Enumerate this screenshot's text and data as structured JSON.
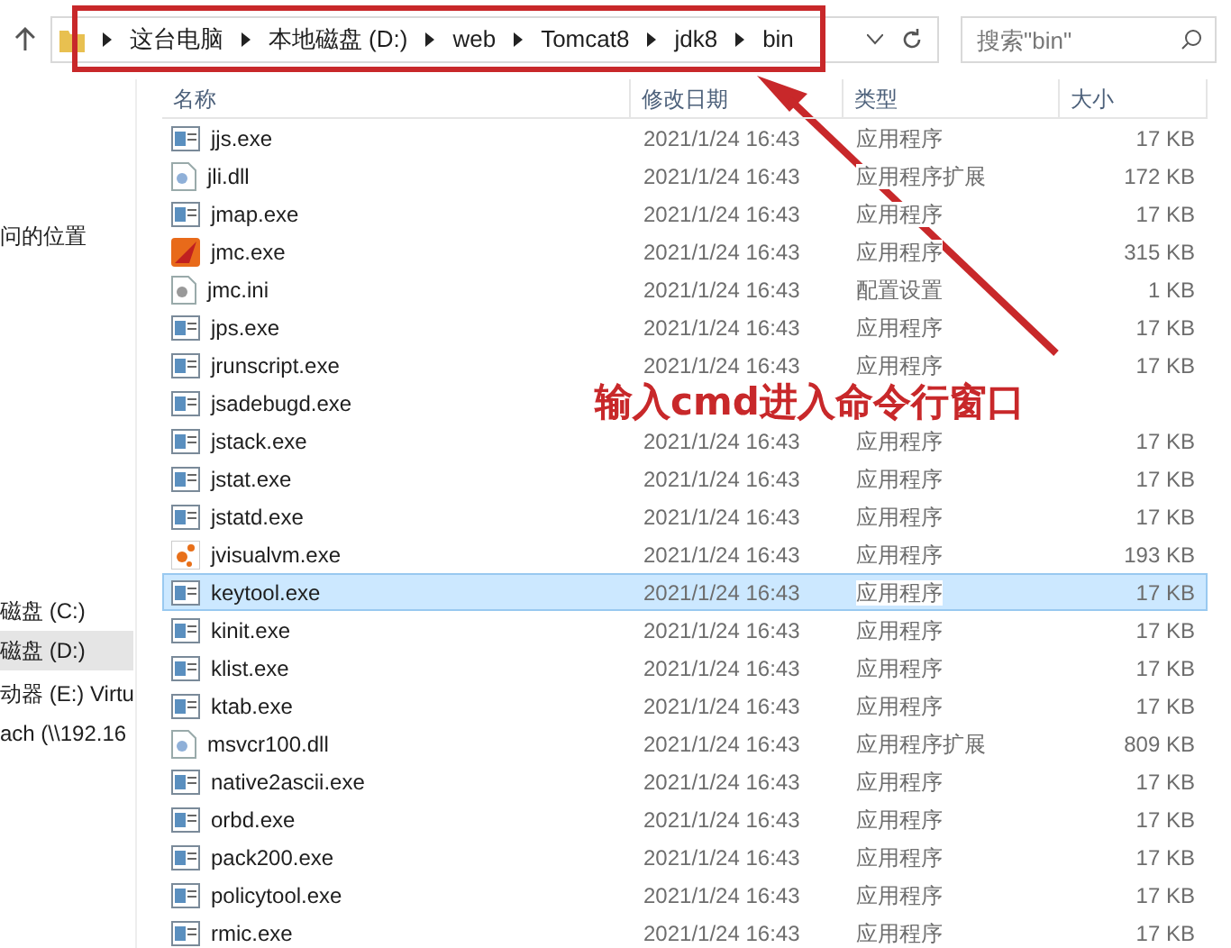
{
  "address_bar": {
    "crumbs": [
      "这台电脑",
      "本地磁盘 (D:)",
      "web",
      "Tomcat8",
      "jdk8",
      "bin"
    ]
  },
  "search": {
    "placeholder": "搜索\"bin\""
  },
  "sidebar": {
    "items": [
      {
        "label": "问的位置",
        "selected": false
      },
      {
        "label": "磁盘 (C:)",
        "selected": false
      },
      {
        "label": "磁盘 (D:)",
        "selected": true
      },
      {
        "label": "动器 (E:) Virtu",
        "selected": false
      },
      {
        "label": "ach (\\\\192.16",
        "selected": false
      }
    ]
  },
  "table": {
    "columns": [
      "名称",
      "修改日期",
      "类型",
      "大小"
    ],
    "rows": [
      {
        "kind": "exe",
        "name": "jjs.exe",
        "date": "2021/1/24 16:43",
        "type": "应用程序",
        "size": "17 KB",
        "selected": false
      },
      {
        "kind": "dll",
        "name": "jli.dll",
        "date": "2021/1/24 16:43",
        "type": "应用程序扩展",
        "size": "172 KB",
        "selected": false
      },
      {
        "kind": "exe",
        "name": "jmap.exe",
        "date": "2021/1/24 16:43",
        "type": "应用程序",
        "size": "17 KB",
        "selected": false
      },
      {
        "kind": "app",
        "name": "jmc.exe",
        "date": "2021/1/24 16:43",
        "type": "应用程序",
        "size": "315 KB",
        "selected": false
      },
      {
        "kind": "ini",
        "name": "jmc.ini",
        "date": "2021/1/24 16:43",
        "type": "配置设置",
        "size": "1 KB",
        "selected": false
      },
      {
        "kind": "exe",
        "name": "jps.exe",
        "date": "2021/1/24 16:43",
        "type": "应用程序",
        "size": "17 KB",
        "selected": false
      },
      {
        "kind": "exe",
        "name": "jrunscript.exe",
        "date": "2021/1/24 16:43",
        "type": "应用程序",
        "size": "17 KB",
        "selected": false
      },
      {
        "kind": "exe",
        "name": "jsadebugd.exe",
        "selected": false
      },
      {
        "kind": "exe",
        "name": "jstack.exe",
        "date": "2021/1/24 16:43",
        "type": "应用程序",
        "size": "17 KB",
        "selected": false
      },
      {
        "kind": "exe",
        "name": "jstat.exe",
        "date": "2021/1/24 16:43",
        "type": "应用程序",
        "size": "17 KB",
        "selected": false
      },
      {
        "kind": "exe",
        "name": "jstatd.exe",
        "date": "2021/1/24 16:43",
        "type": "应用程序",
        "size": "17 KB",
        "selected": false
      },
      {
        "kind": "visual",
        "name": "jvisualvm.exe",
        "date": "2021/1/24 16:43",
        "type": "应用程序",
        "size": "193 KB",
        "selected": false
      },
      {
        "kind": "exe",
        "name": "keytool.exe",
        "date": "2021/1/24 16:43",
        "type": "应用程序",
        "size": "17 KB",
        "selected": true
      },
      {
        "kind": "exe",
        "name": "kinit.exe",
        "date": "2021/1/24 16:43",
        "type": "应用程序",
        "size": "17 KB",
        "selected": false
      },
      {
        "kind": "exe",
        "name": "klist.exe",
        "date": "2021/1/24 16:43",
        "type": "应用程序",
        "size": "17 KB",
        "selected": false
      },
      {
        "kind": "exe",
        "name": "ktab.exe",
        "date": "2021/1/24 16:43",
        "type": "应用程序",
        "size": "17 KB",
        "selected": false
      },
      {
        "kind": "dll",
        "name": "msvcr100.dll",
        "date": "2021/1/24 16:43",
        "type": "应用程序扩展",
        "size": "809 KB",
        "selected": false
      },
      {
        "kind": "exe",
        "name": "native2ascii.exe",
        "date": "2021/1/24 16:43",
        "type": "应用程序",
        "size": "17 KB",
        "selected": false
      },
      {
        "kind": "exe",
        "name": "orbd.exe",
        "date": "2021/1/24 16:43",
        "type": "应用程序",
        "size": "17 KB",
        "selected": false
      },
      {
        "kind": "exe",
        "name": "pack200.exe",
        "date": "2021/1/24 16:43",
        "type": "应用程序",
        "size": "17 KB",
        "selected": false
      },
      {
        "kind": "exe",
        "name": "policytool.exe",
        "date": "2021/1/24 16:43",
        "type": "应用程序",
        "size": "17 KB",
        "selected": false
      },
      {
        "kind": "exe",
        "name": "rmic.exe",
        "date": "2021/1/24 16:43",
        "type": "应用程序",
        "size": "17 KB",
        "selected": false
      }
    ]
  },
  "annotation": {
    "text": "输入cmd进入命令行窗口"
  }
}
